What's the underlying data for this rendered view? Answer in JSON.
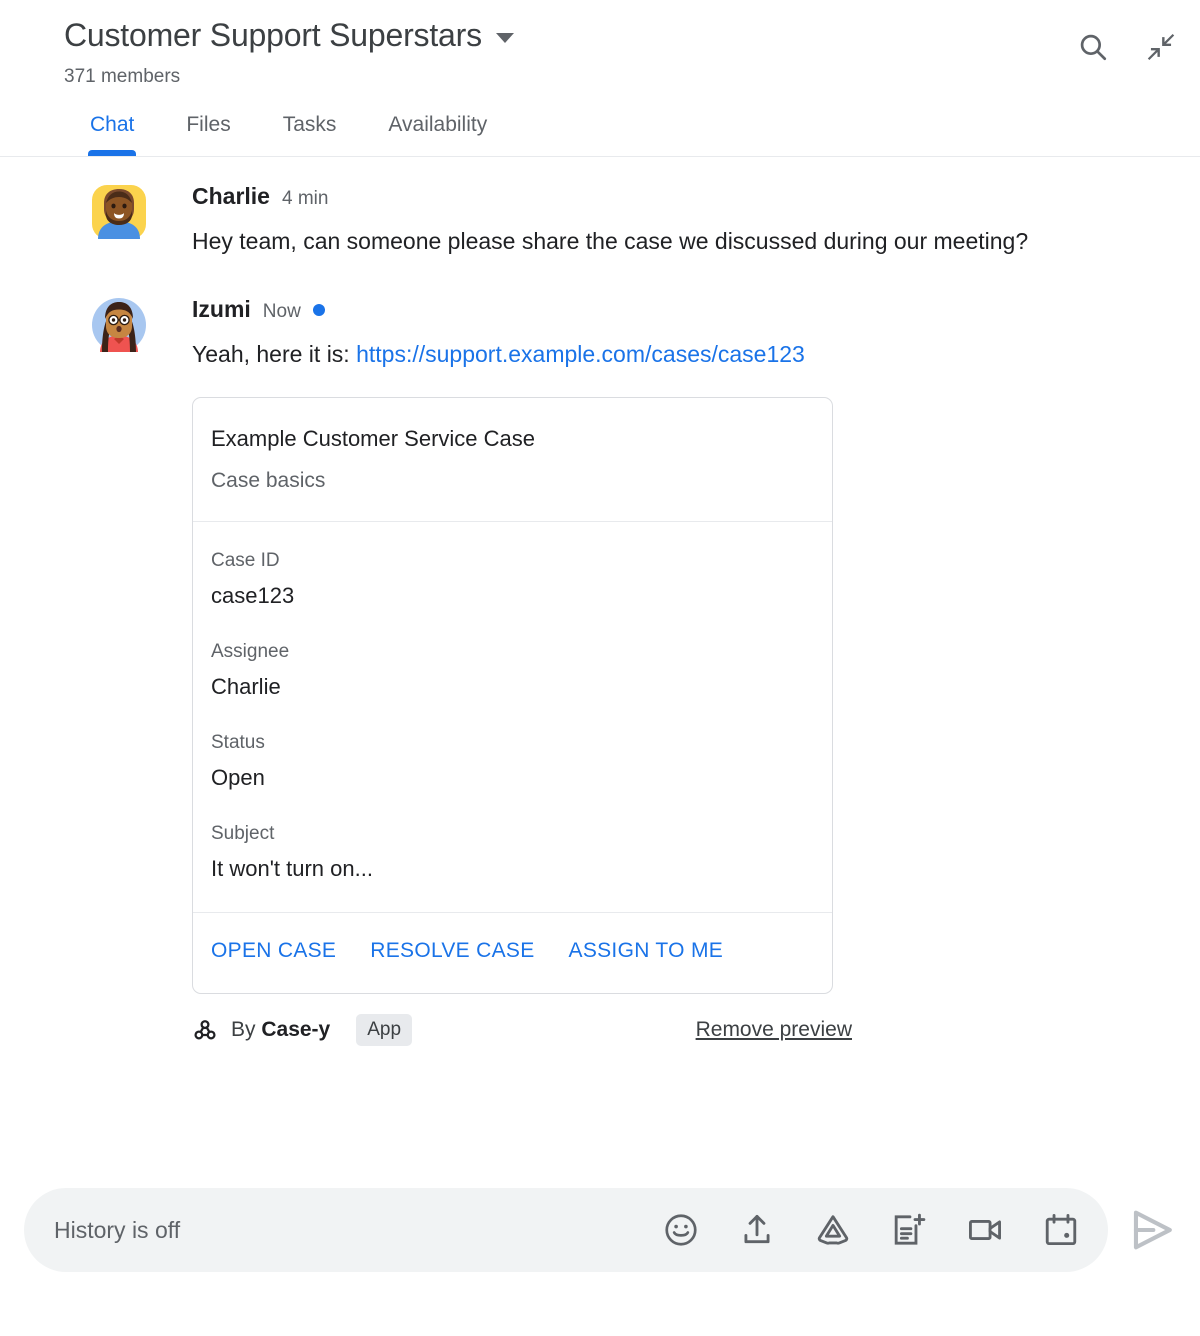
{
  "header": {
    "space_title": "Customer Support Superstars",
    "members": "371 members",
    "dropdown_icon": "chevron-down-icon",
    "search_icon": "search-icon",
    "collapse_icon": "collapse-icon"
  },
  "tabs": [
    {
      "label": "Chat",
      "active": true
    },
    {
      "label": "Files",
      "active": false
    },
    {
      "label": "Tasks",
      "active": false
    },
    {
      "label": "Availability",
      "active": false
    }
  ],
  "messages": [
    {
      "sender": "Charlie",
      "time": "4 min",
      "unread": false,
      "text": "Hey team, can someone please share the case we discussed during our meeting?"
    },
    {
      "sender": "Izumi",
      "time": "Now",
      "unread": true,
      "text_before_link": "Yeah, here it is: ",
      "link": "https://support.example.com/cases/case123"
    }
  ],
  "card": {
    "title": "Example Customer Service Case",
    "subtitle": "Case basics",
    "fields": [
      {
        "label": "Case ID",
        "value": "case123"
      },
      {
        "label": "Assignee",
        "value": "Charlie"
      },
      {
        "label": "Status",
        "value": "Open"
      },
      {
        "label": "Subject",
        "value": "It won't turn on..."
      }
    ],
    "actions": [
      "OPEN CASE",
      "RESOLVE CASE",
      "ASSIGN TO ME"
    ]
  },
  "attribution": {
    "icon": "webhook-icon",
    "by_prefix": "By ",
    "app_name": "Case-y",
    "badge": "App",
    "remove_preview": "Remove preview"
  },
  "composer": {
    "placeholder": "History is off",
    "icons": [
      "emoji-icon",
      "upload-icon",
      "google-drive-icon",
      "create-doc-icon",
      "video-camera-icon",
      "calendar-icon"
    ],
    "send_icon": "send-icon"
  },
  "colors": {
    "accent": "#1a73e8",
    "text_primary": "#202124",
    "text_secondary": "#5f6368",
    "border": "#dadce0",
    "composer_bg": "#f1f3f4"
  }
}
